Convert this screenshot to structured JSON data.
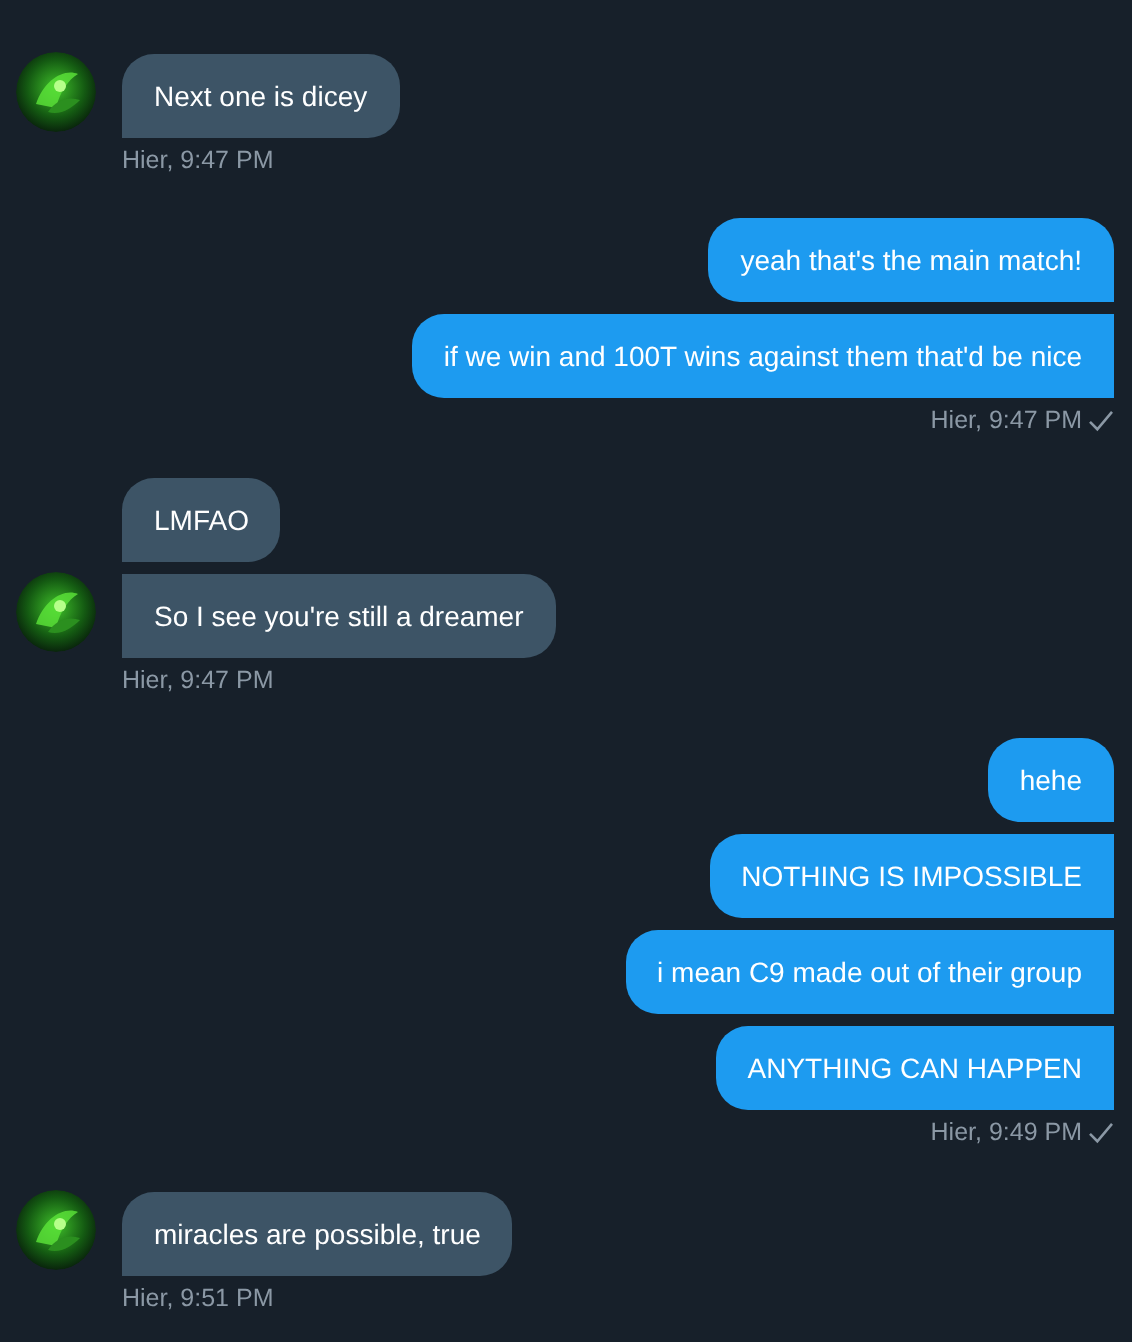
{
  "conversation": [
    {
      "kind": "incoming",
      "messages": [
        "Next one is dicey"
      ],
      "time": "Hier, 9:47 PM"
    },
    {
      "kind": "outgoing",
      "messages": [
        "yeah that's the main match!",
        "if we win and 100T wins against them that'd be nice"
      ],
      "time": "Hier, 9:47 PM",
      "seen": true
    },
    {
      "kind": "incoming",
      "messages": [
        "LMFAO",
        "So I see you're still a dreamer"
      ],
      "time": "Hier, 9:47 PM"
    },
    {
      "kind": "outgoing",
      "messages": [
        "hehe",
        "NOTHING IS IMPOSSIBLE",
        "i mean C9 made out of their group",
        "ANYTHING CAN HAPPEN"
      ],
      "time": "Hier, 9:49 PM",
      "seen": true
    },
    {
      "kind": "incoming",
      "messages": [
        "miracles are possible, true"
      ],
      "time": "Hier, 9:51 PM"
    }
  ]
}
